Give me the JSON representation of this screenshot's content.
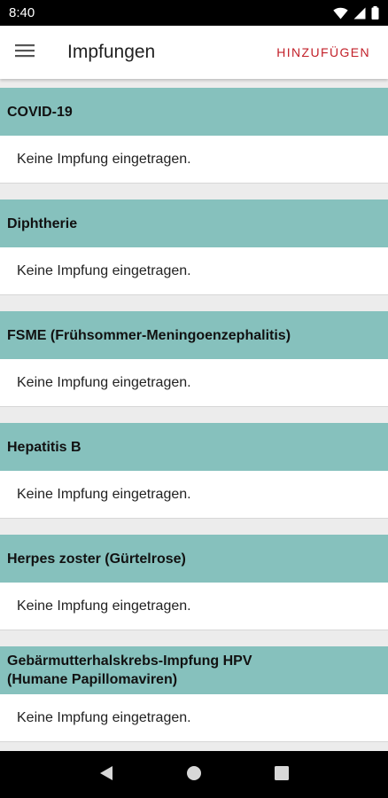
{
  "status_bar": {
    "time": "8:40",
    "icons": [
      "wifi-icon",
      "signal-icon",
      "battery-icon"
    ]
  },
  "app_bar": {
    "title": "Impfungen",
    "add_label": "HINZUFÜGEN",
    "accent_color": "#c21f28"
  },
  "sections": [
    {
      "title": "COVID-19",
      "body": "Keine Impfung eingetragen."
    },
    {
      "title": "Diphtherie",
      "body": "Keine Impfung eingetragen."
    },
    {
      "title": "FSME (Frühsommer-Meningoenzephalitis)",
      "body": "Keine Impfung eingetragen."
    },
    {
      "title": "Hepatitis B",
      "body": "Keine Impfung eingetragen."
    },
    {
      "title": "Herpes zoster (Gürtelrose)",
      "body": "Keine Impfung eingetragen."
    },
    {
      "title": "Gebärmutterhalskrebs-Impfung HPV (Humane Papillomaviren)",
      "body": "Keine Impfung eingetragen."
    }
  ],
  "colors": {
    "section_header_bg": "#86c1bd",
    "background": "#ececec"
  },
  "nav_bar": {
    "buttons": [
      "back-icon",
      "home-icon",
      "recents-icon"
    ]
  }
}
